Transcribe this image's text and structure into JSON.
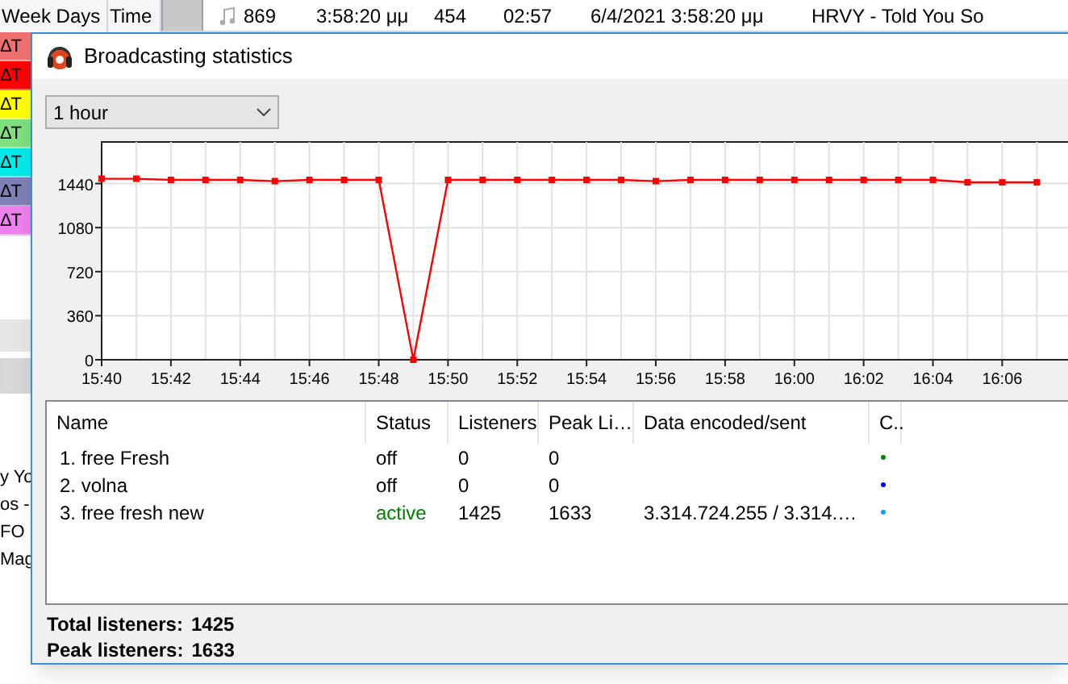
{
  "background_app": {
    "columns": [
      {
        "label": "Week Days"
      },
      {
        "label": "Time"
      }
    ],
    "now_playing": {
      "number": "869",
      "time": "3:58:20 μμ",
      "column_3": "454",
      "duration": "02:57",
      "date_time": "6/4/2021 3:58:20 μμ",
      "title": "HRVY - Told You So"
    },
    "color_rows": [
      {
        "label": "ΔΤ",
        "color": "#f07070"
      },
      {
        "label": "ΔΤ",
        "color": "#ff0000"
      },
      {
        "label": "ΔΤ",
        "color": "#ffff00"
      },
      {
        "label": "ΔΤ",
        "color": "#7ee07e"
      },
      {
        "label": "ΔΤ",
        "color": "#00eaea"
      },
      {
        "label": "ΔΤ",
        "color": "#8080b8"
      },
      {
        "label": "ΔΤ",
        "color": "#f080f0"
      }
    ],
    "partial_texts": [
      "y Yo",
      "os -",
      "FO",
      "Mag"
    ]
  },
  "dialog": {
    "title": "Broadcasting statistics",
    "period": "1 hour",
    "chart_data": {
      "type": "line",
      "categories": [
        "15:40",
        null,
        "15:42",
        null,
        "15:44",
        null,
        "15:46",
        null,
        "15:48",
        null,
        "15:50",
        null,
        "15:52",
        null,
        "15:54",
        null,
        "15:56",
        null,
        "15:58",
        null,
        "16:00",
        null,
        "16:02",
        null,
        "16:04",
        null,
        "16:06",
        null
      ],
      "series": [
        {
          "color": "#ff0000",
          "marker": "square",
          "values": [
            1480,
            1480,
            1470,
            1470,
            1470,
            1460,
            1470,
            1470,
            1470,
            0,
            1470,
            1470,
            1470,
            1470,
            1470,
            1470,
            1460,
            1470,
            1470,
            1470,
            1470,
            1470,
            1470,
            1470,
            1470,
            1450,
            1450,
            1450
          ]
        }
      ],
      "ylim": [
        0,
        1780
      ],
      "yticks": [
        0,
        360,
        720,
        1080,
        1440
      ],
      "grid": true
    },
    "table": {
      "columns": [
        "Name",
        "Status",
        "Listeners",
        "Peak Li…",
        "Data encoded/sent",
        "C.."
      ],
      "rows": [
        {
          "name": "1. free Fresh",
          "status": "off",
          "active": false,
          "listeners": "0",
          "peak": "0",
          "color": "#008000"
        },
        {
          "name": "2. volna",
          "status": "off",
          "active": false,
          "listeners": "0",
          "peak": "0",
          "color": "#0000ff"
        },
        {
          "name": "3. free fresh new",
          "status": "active",
          "active": true,
          "listeners": "1425",
          "peak": "1633",
          "data": "3.314.724.255 / 3.314.…",
          "color": "#00a8e8"
        }
      ]
    },
    "total_listeners": {
      "label": "Total listeners:",
      "value": "1425"
    },
    "peak_listeners": {
      "label": "Peak listeners:",
      "value": "1633"
    }
  }
}
